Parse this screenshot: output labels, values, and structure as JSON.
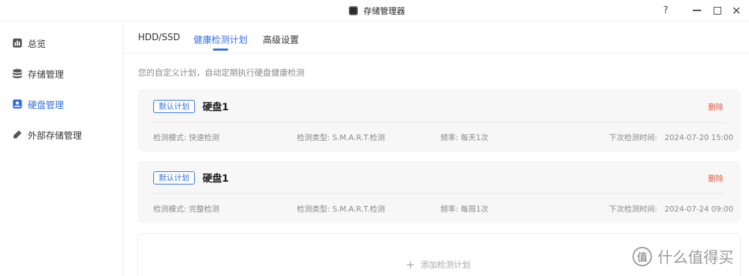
{
  "window": {
    "title": "存储管理器",
    "help_label": "?",
    "close_label": "✕"
  },
  "sidebar": {
    "items": [
      {
        "label": "总览",
        "icon": "overview-icon",
        "active": false
      },
      {
        "label": "存储管理",
        "icon": "database-icon",
        "active": false
      },
      {
        "label": "硬盘管理",
        "icon": "disk-icon",
        "active": true
      },
      {
        "label": "外部存储管理",
        "icon": "external-storage-icon",
        "active": false
      }
    ]
  },
  "tabs": [
    {
      "label": "HDD/SSD",
      "active": false
    },
    {
      "label": "健康检测计划",
      "active": true
    },
    {
      "label": "高级设置",
      "active": false
    }
  ],
  "main": {
    "description": "您的自定义计划，自动定期执行硬盘健康检测",
    "plans": [
      {
        "badge": "默认计划",
        "name": "硬盘1",
        "delete_label": "删除",
        "mode": "检测模式: 快速检测",
        "type": "检测类型: S.M.A.R.T.检测",
        "frequency": "频率: 每天1次",
        "next_run": "下次检测时间:   2024-07-20 15:00"
      },
      {
        "badge": "默认计划",
        "name": "硬盘1",
        "delete_label": "删除",
        "mode": "检测模式: 完整检测",
        "type": "检测类型: S.M.A.R.T.检测",
        "frequency": "频率: 每周1次",
        "next_run": "下次检测时间:   2024-07-24 09:00"
      }
    ],
    "add_label": "添加检测计划"
  },
  "watermark": {
    "logo_text": "值",
    "text": "什么值得买"
  },
  "colors": {
    "accent": "#2f6ee5",
    "danger": "#e05a3c",
    "muted": "#8a8a8a",
    "card_bg": "#f7f7f8"
  }
}
